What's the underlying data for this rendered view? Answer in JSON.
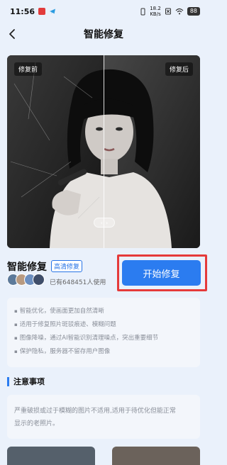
{
  "status_bar": {
    "time": "11:56",
    "network_speed_value": "18.2",
    "network_speed_unit": "KB/s",
    "battery": "88"
  },
  "nav": {
    "title": "智能修复"
  },
  "compare": {
    "before_label": "修复前",
    "after_label": "修复后",
    "slider_position": 0.5
  },
  "feature": {
    "title": "智能修复",
    "badge": "高清修复",
    "usage": "已有648451人使用",
    "start_button": "开始修复"
  },
  "benefits": [
    "智能优化，使画面更加自然清晰",
    "适用于修复照片斑驳痕迹、模糊问题",
    "图像降噪，通过AI智能识别清理噪点，突出重要细节",
    "保护隐私，服务器不留存用户图像"
  ],
  "notice": {
    "heading": "注意事项",
    "text_line1": "严重破损或过于模糊的图片不适用,适用于待优化但能正常",
    "text_line2": "显示的老照片。"
  },
  "colors": {
    "accent": "#2b7cf0",
    "highlight": "#e53a3a",
    "background": "#eaf1fb"
  }
}
